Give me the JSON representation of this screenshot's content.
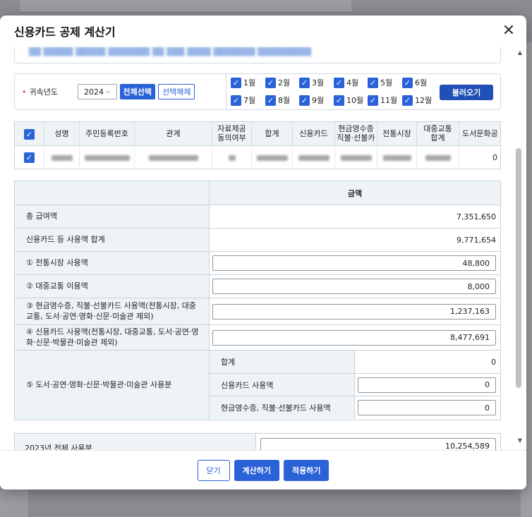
{
  "modal": {
    "title": "신용카드 공제 계산기",
    "close_icon": "close-icon"
  },
  "filter": {
    "year_label": "귀속년도",
    "year_value": "2024",
    "select_all": "전체선택",
    "deselect_all": "선택해제",
    "months": [
      "1월",
      "2월",
      "3월",
      "4월",
      "5월",
      "6월",
      "7월",
      "8월",
      "9월",
      "10월",
      "11월",
      "12월"
    ],
    "load_button": "불러오기"
  },
  "grid": {
    "columns": [
      "성명",
      "주민등록번호",
      "관계",
      "자료제공동의여부",
      "합계",
      "신용카드",
      "현금영수증직불·선불카",
      "전통시장",
      "대중교통합계",
      "도서문화공"
    ],
    "columns_display": {
      "name": "성명",
      "rrn": "주민등록번호",
      "relation": "관계",
      "consent_1": "자료제공",
      "consent_2": "동의여부",
      "total": "합계",
      "credit": "신용카드",
      "cash_1": "현금영수증",
      "cash_2": "직불·선불카",
      "market": "전통시장",
      "transit_1": "대중교통",
      "transit_2": "합계",
      "books": "도서문화공"
    },
    "row_last_value": "0"
  },
  "amount_table": {
    "header": "금액",
    "rows": {
      "total_salary_label": "총 급여액",
      "total_salary_value": "7,351,650",
      "card_total_label": "신용카드 등 사용액 합계",
      "card_total_value": "9,771,654",
      "market_label": "① 전통시장 사용액",
      "market_value": "48,800",
      "transit_label": "② 대중교통 이용액",
      "transit_value": "8,000",
      "cash_label": "③ 현금영수증, 직불·선불카드 사용액(전통시장, 대중교통, 도서·공연·영화·신문·미술관 제외)",
      "cash_value": "1,237,163",
      "credit_label": "④ 신용카드 사용액(전통시장, 대중교통, 도서·공연·영화·신문·박물관·미술관 제외)",
      "credit_value": "8,477,691",
      "books_label": "⑤ 도서·공연·영화·신문·박물관·미술관 사용분",
      "books_sum_label": "합계",
      "books_sum_value": "0",
      "books_credit_label": "신용카드 사용액",
      "books_credit_value": "0",
      "books_cash_label": "현금영수증, 직불·선불카드 사용액",
      "books_cash_value": "0"
    }
  },
  "previous": {
    "label": "2023년 전체 사용분",
    "value": "10,254,589"
  },
  "footer": {
    "close": "닫기",
    "calculate": "계산하기",
    "apply": "적용하기"
  }
}
